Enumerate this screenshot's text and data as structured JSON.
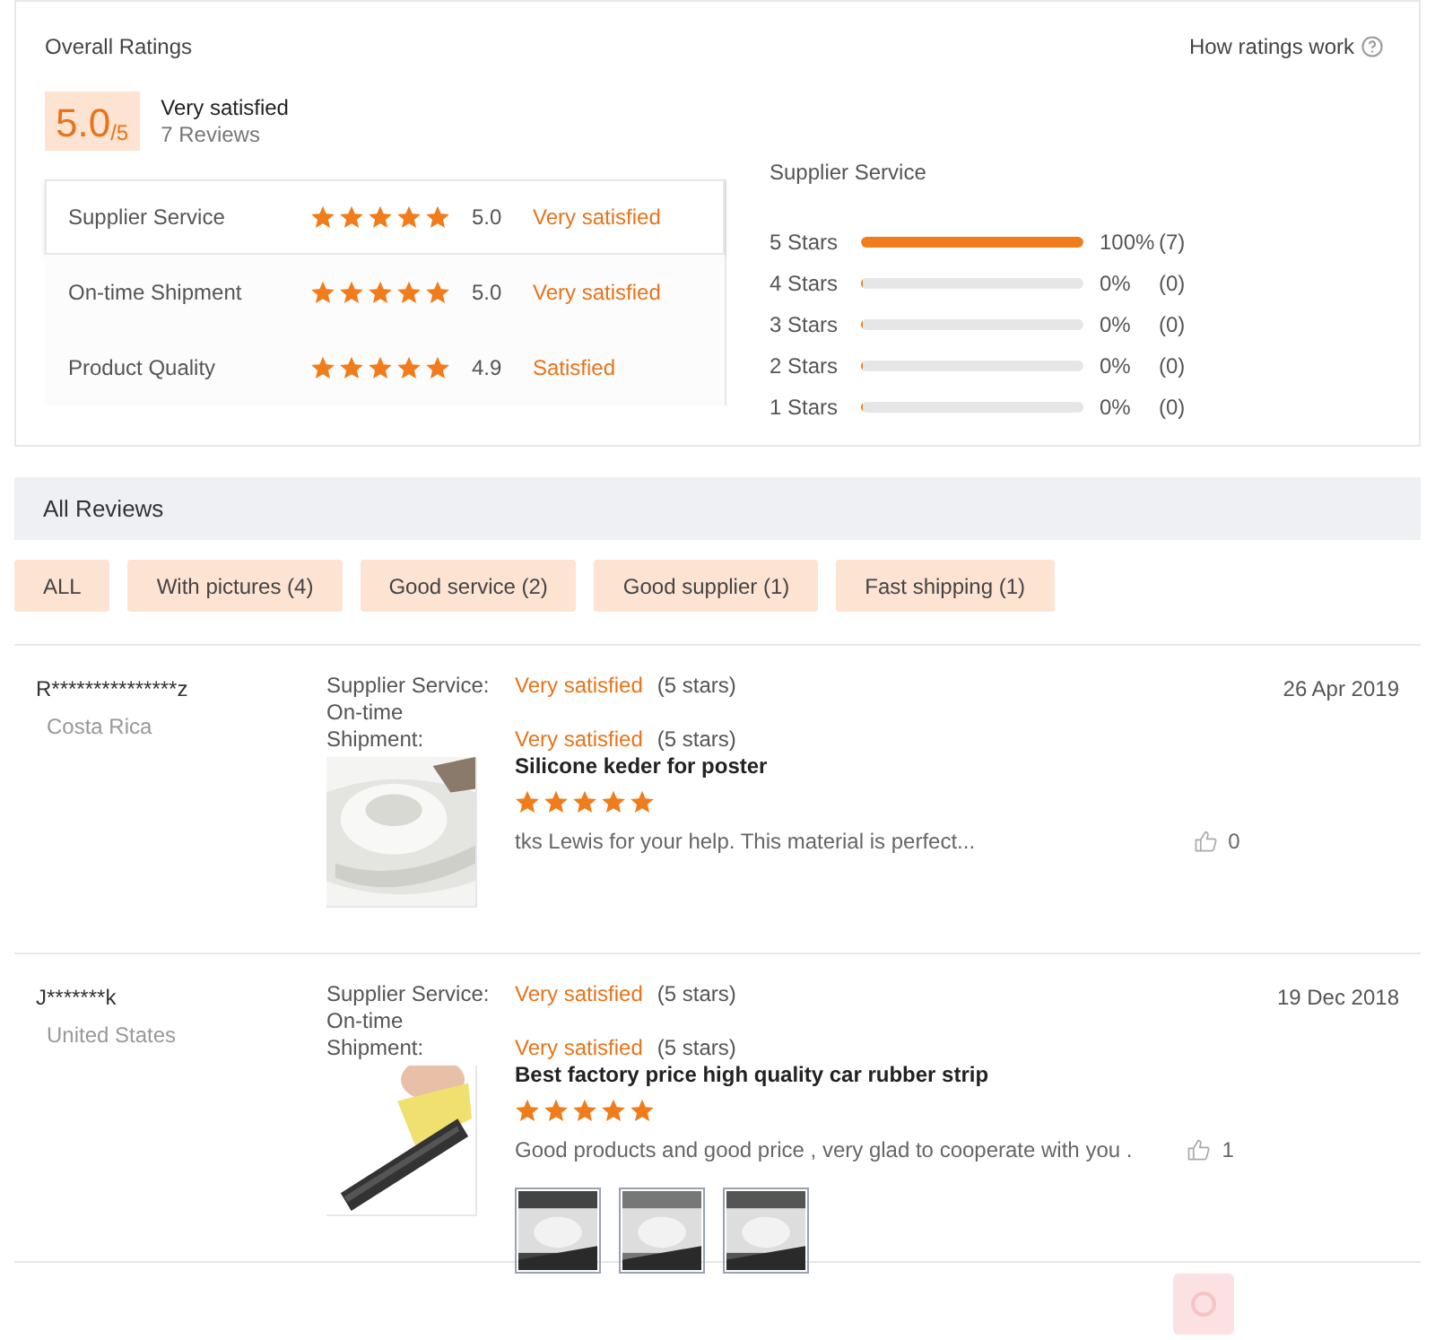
{
  "overall": {
    "title": "Overall Ratings",
    "help_link": "How ratings work",
    "score": "5.0",
    "score_max": "/5",
    "verdict": "Very satisfied",
    "reviews_count": "7 Reviews"
  },
  "categories": [
    {
      "name": "Supplier Service",
      "stars": 5,
      "score": "5.0",
      "verdict": "Very satisfied",
      "selected": true
    },
    {
      "name": "On-time Shipment",
      "stars": 5,
      "score": "5.0",
      "verdict": "Very satisfied",
      "selected": false
    },
    {
      "name": "Product Quality",
      "stars": 5,
      "score": "4.9",
      "verdict": "Satisfied",
      "selected": false
    }
  ],
  "distribution": {
    "title": "Supplier Service",
    "rows": [
      {
        "label": "5 Stars",
        "level": 1,
        "percent": "100%",
        "count": "(7)"
      },
      {
        "label": "4 Stars",
        "level": 0,
        "percent": "0%",
        "count": "(0)"
      },
      {
        "label": "3 Stars",
        "level": 0,
        "percent": "0%",
        "count": "(0)"
      },
      {
        "label": "2 Stars",
        "level": 0,
        "percent": "0%",
        "count": "(0)"
      },
      {
        "label": "1 Stars",
        "level": 0,
        "percent": "0%",
        "count": "(0)"
      }
    ]
  },
  "all_reviews": {
    "title": "All Reviews"
  },
  "filters": [
    {
      "label": "ALL"
    },
    {
      "label": "With pictures (4)"
    },
    {
      "label": "Good service (2)"
    },
    {
      "label": "Good supplier (1)"
    },
    {
      "label": "Fast shipping (1)"
    }
  ],
  "reviews": [
    {
      "user": "R***************z",
      "country": "Costa Rica",
      "date": "26 Apr 2019",
      "ratings": [
        {
          "label": "Supplier Service:",
          "verdict": "Very satisfied",
          "stars_text": "(5 stars)"
        },
        {
          "label": "On-time Shipment:",
          "verdict": "Very satisfied",
          "stars_text": "(5 stars)"
        }
      ],
      "product": "Silicone keder for poster",
      "stars": 5,
      "text": "tks Lewis for your help. This material is perfect...",
      "likes": "0",
      "product_image": {
        "kind": "picture"
      }
    },
    {
      "user": "J*******k",
      "country": "United States",
      "date": "19 Dec 2018",
      "ratings": [
        {
          "label": "Supplier Service:",
          "verdict": "Very satisfied",
          "stars_text": "(5 stars)"
        },
        {
          "label": "On-time Shipment:",
          "verdict": "Very satisfied",
          "stars_text": "(5 stars)"
        }
      ],
      "product": "Best factory price high quality car rubber strip",
      "stars": 5,
      "text": "Good products and good price , very glad to cooperate with you .",
      "likes": "1",
      "product_image": {
        "kind": "picture"
      },
      "attachments": [
        {
          "kind": "picture"
        },
        {
          "kind": "picture"
        },
        {
          "kind": "picture"
        }
      ]
    }
  ]
}
